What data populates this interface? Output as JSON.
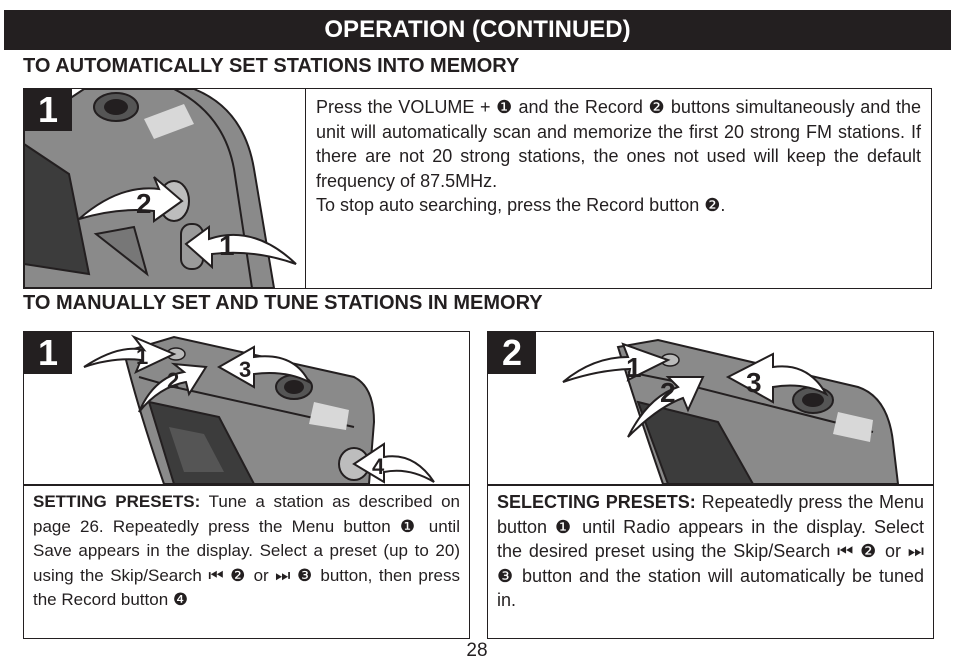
{
  "header": {
    "title": "OPERATION (CONTINUED)"
  },
  "section_auto": {
    "title": "TO AUTOMATICALLY SET STATIONS INTO MEMORY",
    "step": "1",
    "callouts": [
      "1",
      "2"
    ],
    "lines": [
      "Press the VOLUME + ❶ and the Record ❷ buttons simultaneously and the unit will automatically scan and memorize the first 20 strong FM stations. If there are not 20 strong stations, the ones not used will keep the default frequency of 87.5MHz.",
      "To stop auto searching, press the Record button ❷."
    ]
  },
  "section_manual": {
    "title": "TO MANUALLY SET AND TUNE STATIONS IN MEMORY",
    "panels": [
      {
        "step": "1",
        "callouts": [
          "1",
          "2",
          "3",
          "4"
        ],
        "heading": "SETTING PRESETS:",
        "text": " Tune a station as described on page 26. Repeatedly press the Menu button ❶ until Save appears in the display. Select a preset (up to 20) using the Skip/Search ⏮ ❷ or ⏭ ❸ button, then press the Record button ❹"
      },
      {
        "step": "2",
        "callouts": [
          "1",
          "2",
          "3"
        ],
        "heading": "SELECTING PRESETS:",
        "text": " Repeatedly press the Menu button ❶ until Radio appears in the display. Select the desired preset using the Skip/Search ⏮ ❷ or ⏭ ❸ button and the station will automatically be tuned in."
      }
    ]
  },
  "footer": {
    "page_number": "28"
  }
}
